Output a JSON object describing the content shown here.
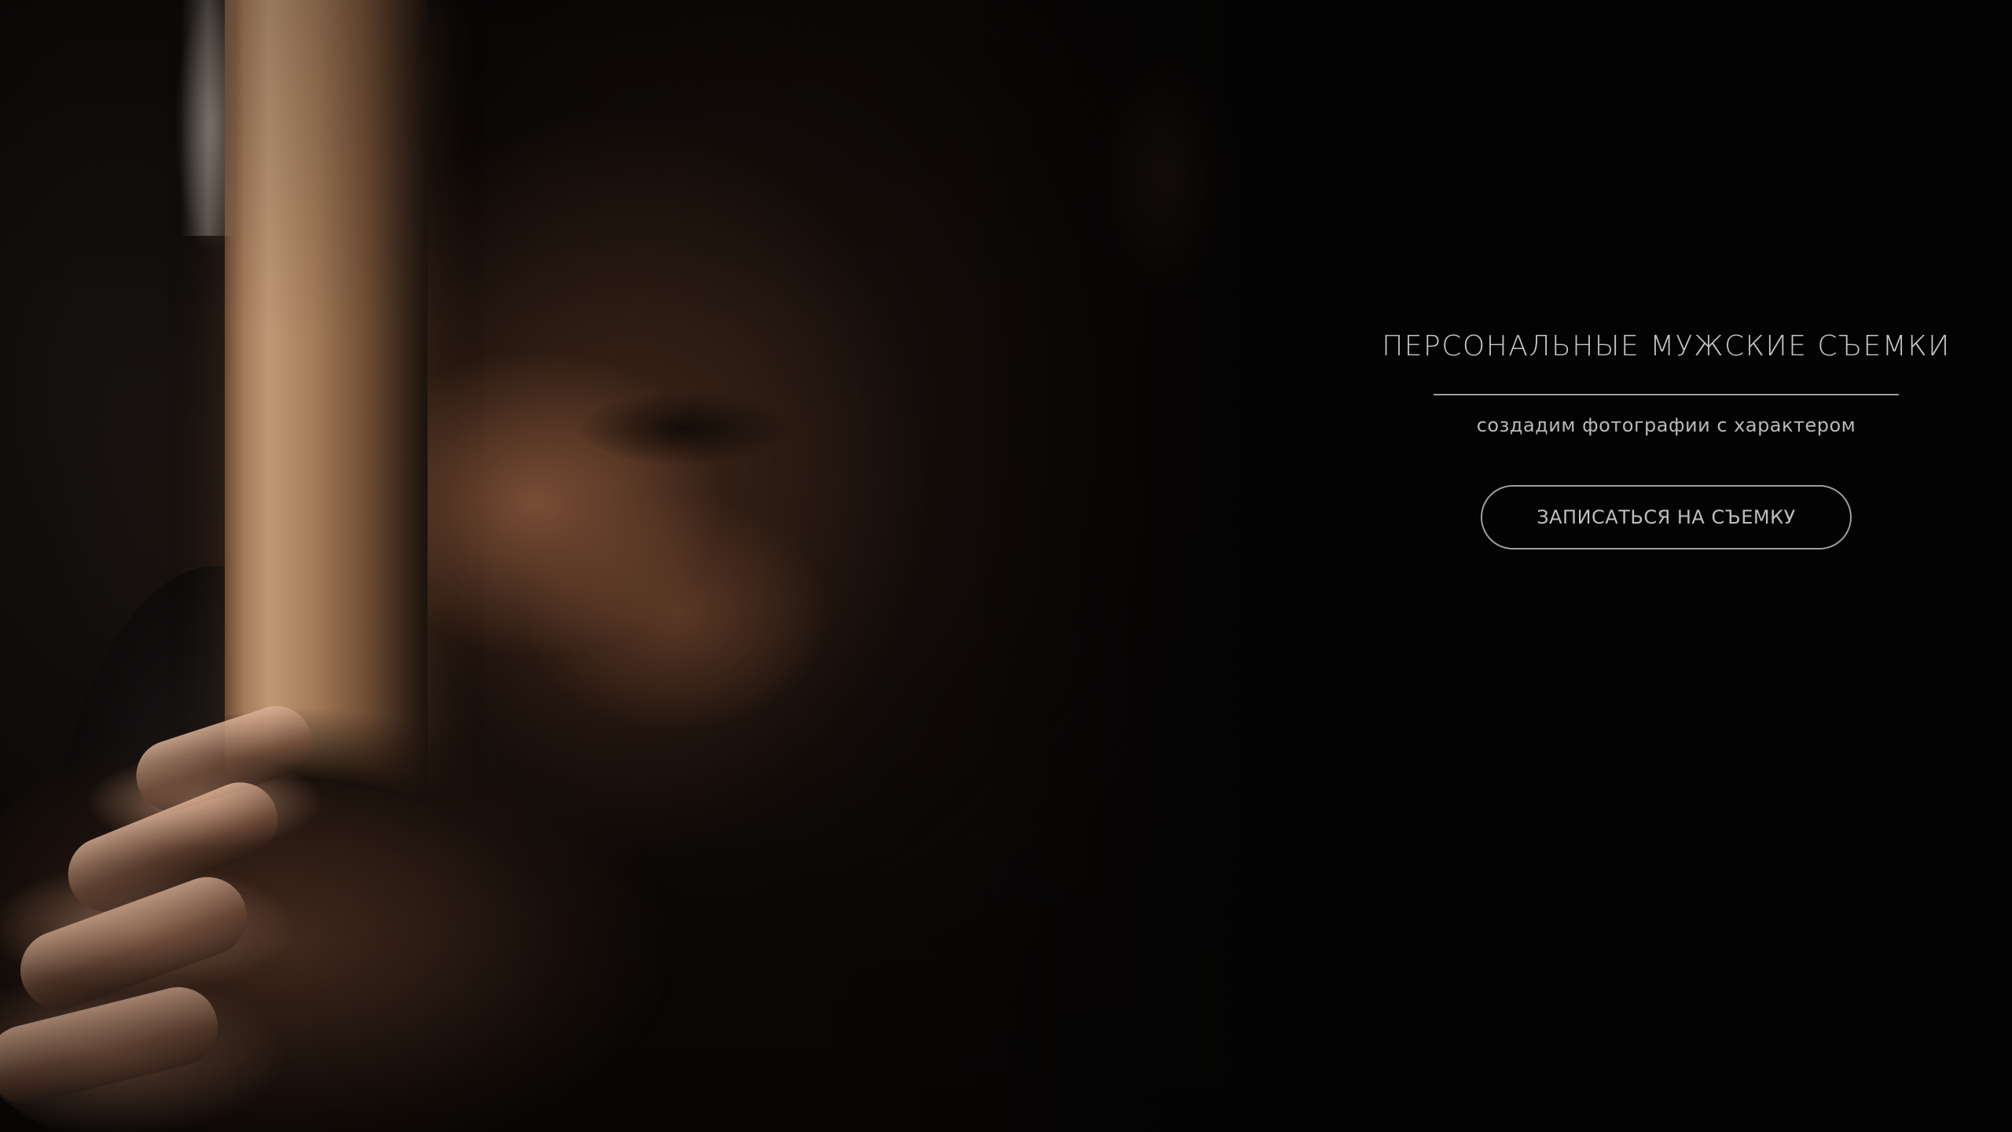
{
  "hero": {
    "image_subject": "man-with-wooden-pole-photo",
    "headline": "ПЕРСОНАЛЬНЫЕ МУЖСКИЕ СЪЕМКИ",
    "subtitle": "создадим фотографии с характером",
    "cta_label": "ЗАПИСАТЬСЯ НА СЪЕМКУ"
  },
  "colors": {
    "background": "#050404",
    "text": "#c6c6c6",
    "button_border": "#9e9e9e"
  }
}
